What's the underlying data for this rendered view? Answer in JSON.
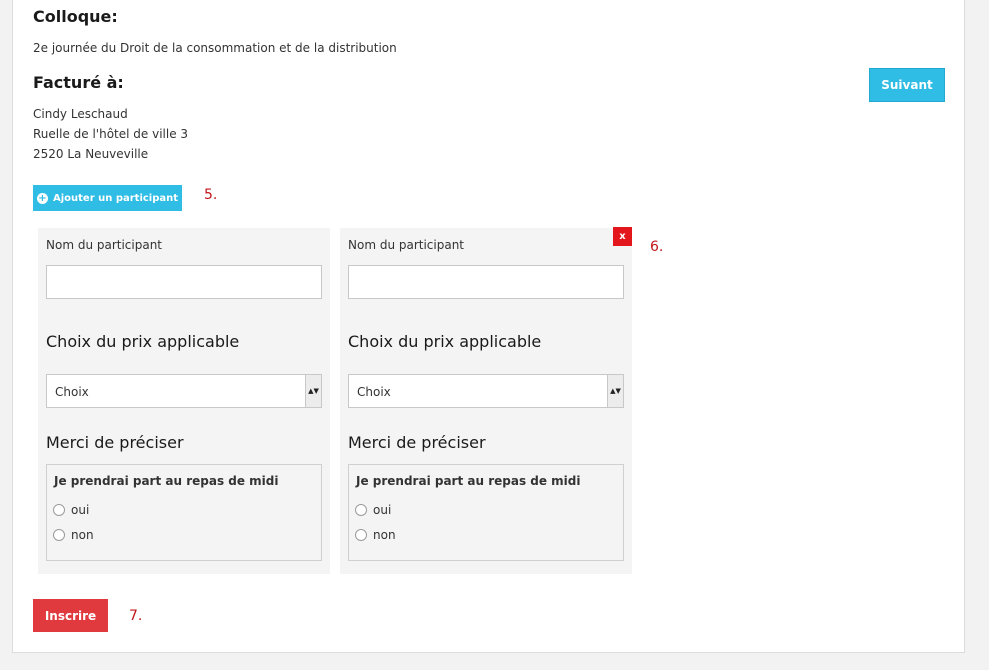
{
  "colloque": {
    "heading": "Colloque:",
    "title": "2e journée du Droit de la consommation et de la distribution"
  },
  "billing": {
    "heading": "Facturé à:",
    "name": "Cindy Leschaud",
    "street": "Ruelle de l'hôtel de ville 3",
    "city": "2520 La Neuveville"
  },
  "buttons": {
    "next_label": "Suivant",
    "add_participant_label": "Ajouter un participant",
    "close_label": "x",
    "submit_label": "Inscrire"
  },
  "annotations": {
    "add": "5.",
    "close": "6.",
    "submit": "7."
  },
  "participants": [
    {
      "name_label": "Nom du participant",
      "name_value": "",
      "price_title": "Choix du prix applicable",
      "price_selected": "Choix",
      "precise_title": "Merci de préciser",
      "question": "Je prendrai part au repas de midi",
      "options": [
        "oui",
        "non"
      ]
    },
    {
      "name_label": "Nom du participant",
      "name_value": "",
      "price_title": "Choix du prix applicable",
      "price_selected": "Choix",
      "precise_title": "Merci de préciser",
      "question": "Je prendrai part au repas de midi",
      "options": [
        "oui",
        "non"
      ]
    }
  ],
  "icons": {
    "add": "plus-circle-icon",
    "select": "select-arrows-icon",
    "close": "close-icon"
  },
  "colors": {
    "primary": "#2fbce5",
    "danger": "#e0393e",
    "annotation": "#c0161a"
  }
}
